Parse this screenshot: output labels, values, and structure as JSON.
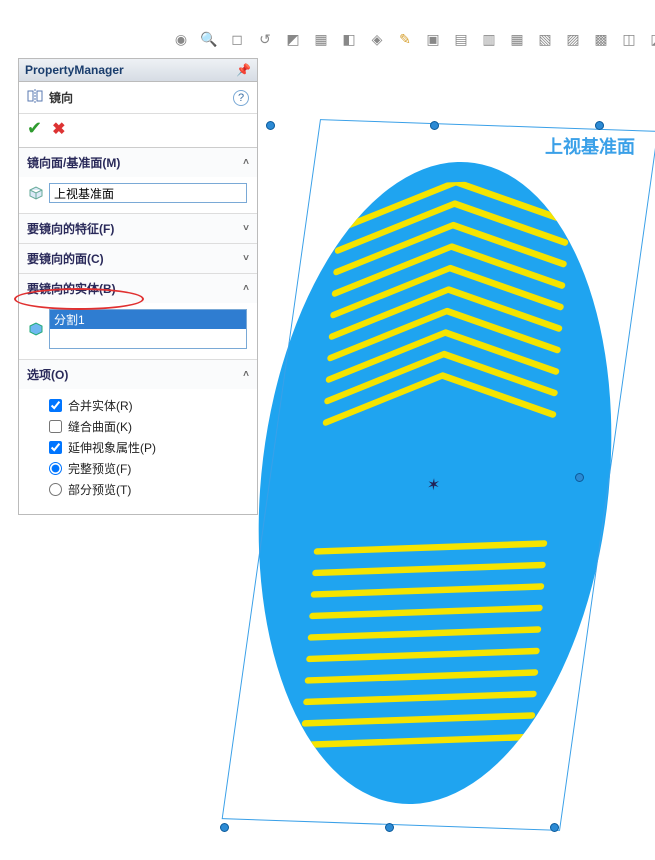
{
  "propertyManager": {
    "header": "PropertyManager",
    "featureTitle": "镜向",
    "ok_tooltip": "确定",
    "cancel_tooltip": "取消",
    "help_label": "?"
  },
  "sections": {
    "mirrorFace": {
      "label": "镜向面/基准面(M)",
      "value": "上视基准面",
      "expanded": true
    },
    "featuresToMirror": {
      "label": "要镜向的特征(F)",
      "expanded": false
    },
    "facesToMirror": {
      "label": "要镜向的面(C)",
      "expanded": false
    },
    "bodiesToMirror": {
      "label": "要镜向的实体(B)",
      "expanded": true,
      "items": [
        "分割1"
      ]
    },
    "options": {
      "label": "选项(O)",
      "expanded": true,
      "mergeSolids": {
        "label": "合并实体(R)",
        "checked": true
      },
      "knit": {
        "label": "缝合曲面(K)",
        "checked": false
      },
      "propagate": {
        "label": "延伸视象属性(P)",
        "checked": true
      },
      "fullPreview": {
        "label": "完整预览(F)",
        "selected": true
      },
      "partialPreview": {
        "label": "部分预览(T)",
        "selected": false
      }
    }
  },
  "viewport": {
    "planeLabel": "上视基准面"
  },
  "toolbar": {
    "items": [
      "orient",
      "fit",
      "zoom",
      "zoomwin",
      "section",
      "view",
      "sketch",
      "annotate",
      "appearance",
      "scene",
      "render",
      "settings",
      "display",
      "hide",
      "window",
      "split",
      "color",
      "macro"
    ]
  }
}
